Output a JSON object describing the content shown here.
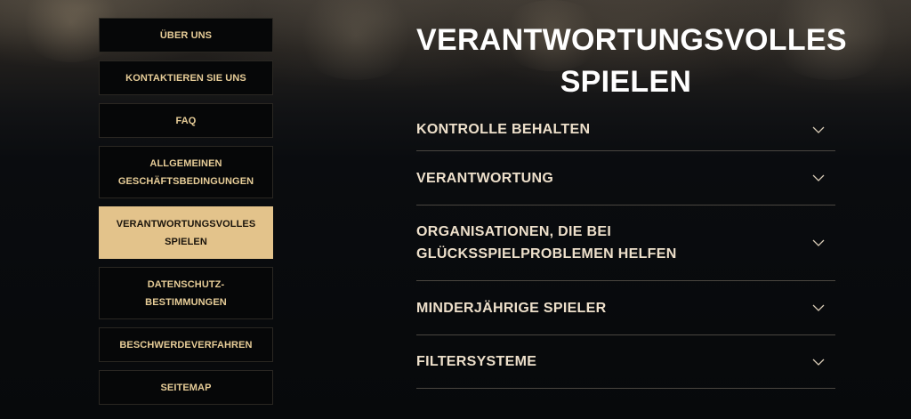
{
  "sidebar": {
    "items": [
      {
        "label": "ÜBER UNS"
      },
      {
        "label": "KONTAKTIEREN SIE UNS"
      },
      {
        "label": "FAQ"
      },
      {
        "label": "ALLGEMEINEN GESCHÄFTSBEDINGUNGEN"
      },
      {
        "label": "VERANTWORTUNGSVOLLES SPIELEN",
        "active": true
      },
      {
        "label": "DATENSCHUTZ-BESTIMMUNGEN"
      },
      {
        "label": "BESCHWERDEVERFAHREN"
      },
      {
        "label": "SEITEMAP"
      }
    ]
  },
  "main": {
    "title": "VERANTWORTUNGSVOLLES SPIELEN",
    "sections": [
      {
        "title": "KONTROLLE BEHALTEN",
        "icon": "chevron-down-icon"
      },
      {
        "title": "VERANTWORTUNG",
        "icon": "chevron-down-icon"
      },
      {
        "title": "ORGANISATIONEN, DIE BEI GLÜCKSSPIELPROBLEMEN HELFEN",
        "icon": "chevron-down-icon"
      },
      {
        "title": "MINDERJÄHRIGE SPIELER",
        "icon": "chevron-down-icon"
      },
      {
        "title": "FILTERSYSTEME",
        "icon": "chevron-down-icon"
      }
    ]
  },
  "colors": {
    "accent": "#e3c38b",
    "nav_text": "#e7cd98",
    "heading": "#ffffff",
    "background": "#07090c"
  }
}
